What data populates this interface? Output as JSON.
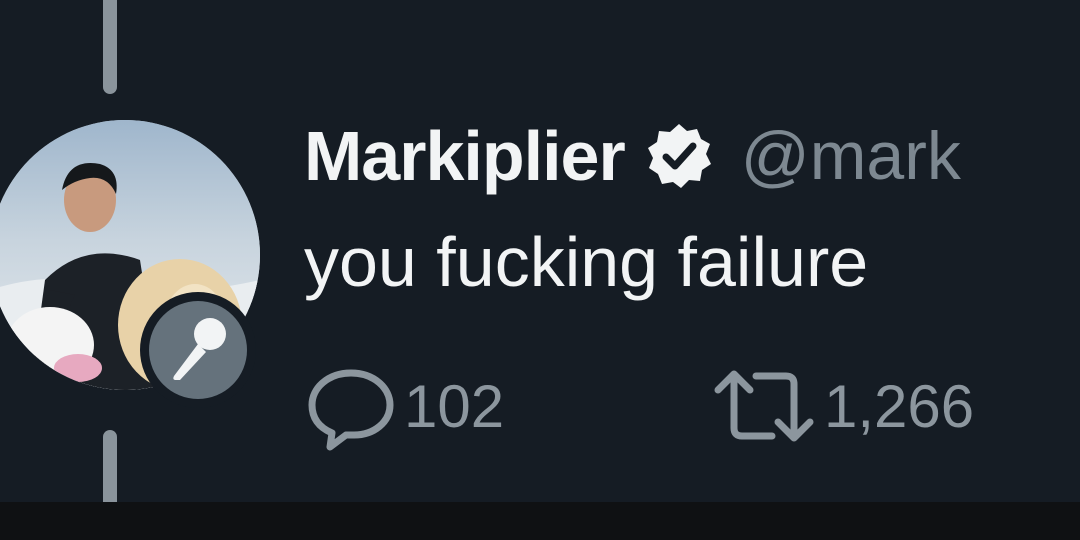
{
  "tweet": {
    "display_name": "Markiplier",
    "handle": "@mark",
    "text": "you fucking failure",
    "verified": true,
    "avatar_badge": "microphone-icon",
    "actions": {
      "reply": {
        "icon": "reply-bubble-icon",
        "count": "102"
      },
      "retweet": {
        "icon": "retweet-icon",
        "count": "1,266"
      }
    }
  },
  "colors": {
    "background": "#151c24",
    "primary_text": "#f2f4f5",
    "secondary_text": "#8c969e",
    "thread_line": "#8a949c",
    "badge": "#65727c"
  }
}
